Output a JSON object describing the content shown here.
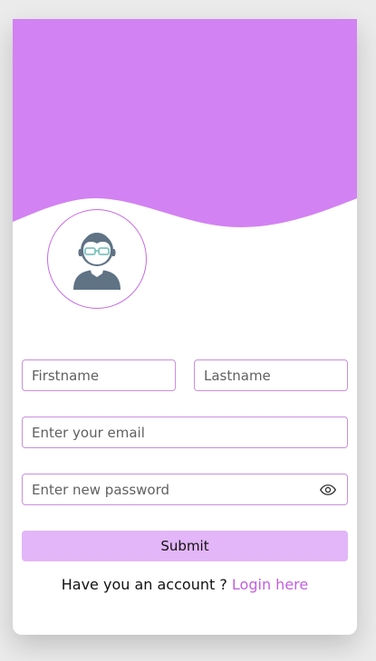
{
  "form": {
    "firstname_placeholder": "Firstname",
    "lastname_placeholder": "Lastname",
    "email_placeholder": "Enter your email",
    "password_placeholder": "Enter new password",
    "submit_label": "Submit"
  },
  "footer": {
    "prompt_text": "Have you an account ?",
    "login_link": "Login here"
  },
  "icons": {
    "avatar": "user-with-glasses-icon",
    "password_toggle": "eye-icon"
  },
  "colors": {
    "header_wave": "#d282f2",
    "accent_border": "#c98fe0",
    "submit_bg": "#e2b6f8",
    "link": "#c45fe0"
  }
}
